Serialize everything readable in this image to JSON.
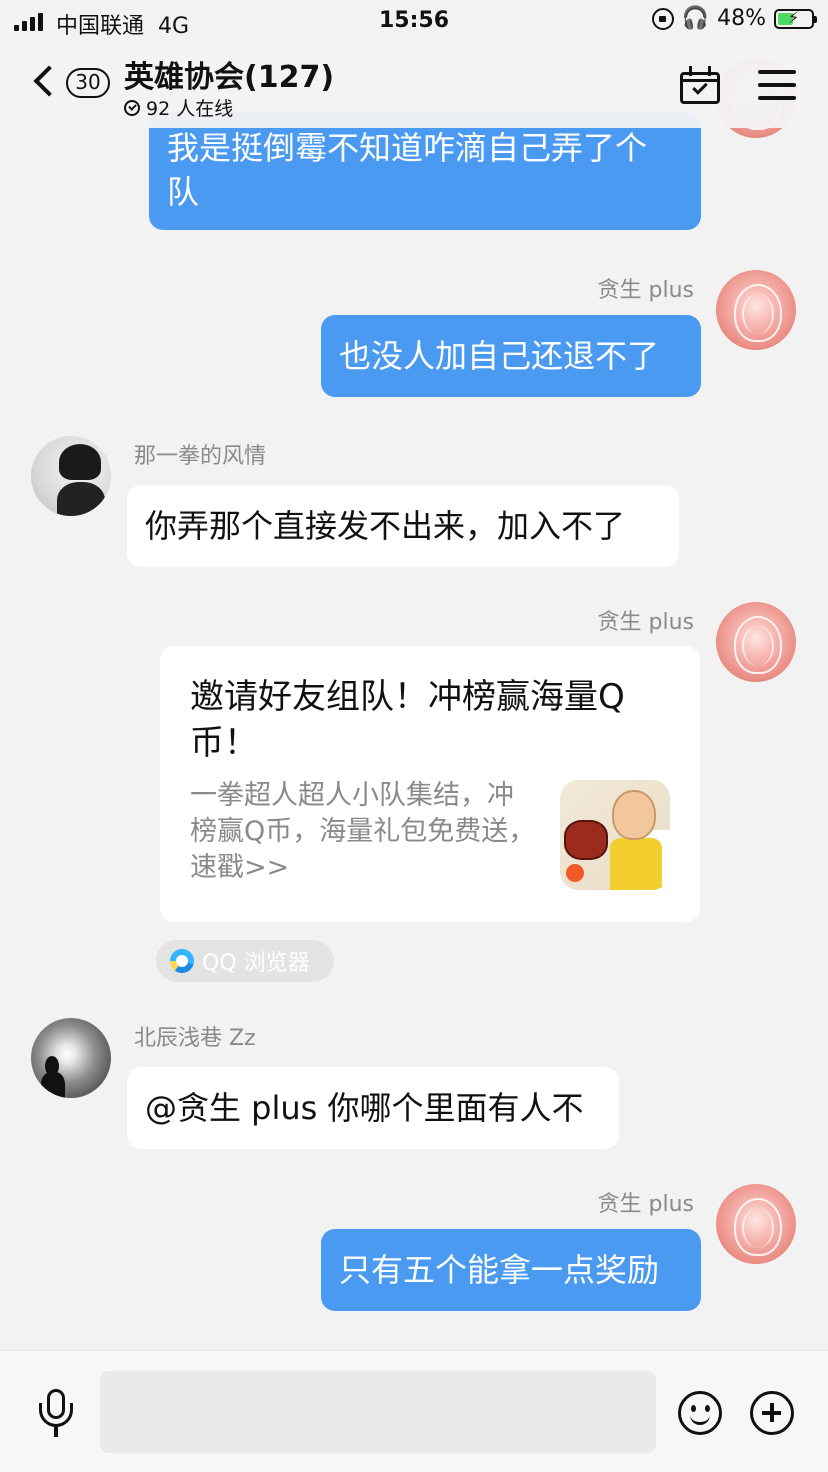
{
  "status": {
    "carrier": "中国联通",
    "network": "4G",
    "time": "15:56",
    "battery": "48%",
    "battery_level": 0.48
  },
  "header": {
    "unread_count": "30",
    "title": "英雄协会(127)",
    "online": "92 人在线"
  },
  "messages": [
    {
      "side": "out",
      "text_lines": [
        "我是挺倒霉不知道咋滴自己弄了个",
        "队"
      ]
    },
    {
      "side": "out",
      "sender": "贪生 plus",
      "text": "也没人加自己还退不了"
    },
    {
      "side": "in",
      "sender": "那一拳的风情",
      "text": "你弄那个直接发不出来，加入不了"
    },
    {
      "side": "out",
      "sender": "贪生 plus",
      "card": {
        "title": "邀请好友组队！冲榜赢海量Q币！",
        "description": "一拳超人超人小队集结，冲榜赢Q币，海量礼包免费送，速戳>>",
        "source": "QQ 浏览器"
      }
    },
    {
      "side": "in",
      "sender": "北辰浅巷 Zz",
      "text": "@贪生 plus 你哪个里面有人不"
    },
    {
      "side": "out",
      "sender": "贪生 plus",
      "text": "只有五个能拿一点奖励"
    }
  ],
  "input": {
    "placeholder": ""
  },
  "colors": {
    "outgoing_bubble": "#4a9af2",
    "incoming_bubble": "#ffffff",
    "background": "#f2f2f2"
  },
  "icons": [
    "back-chevron-icon",
    "calendar-check-icon",
    "menu-icon",
    "microphone-icon",
    "emoji-icon",
    "plus-icon",
    "qq-browser-icon"
  ]
}
